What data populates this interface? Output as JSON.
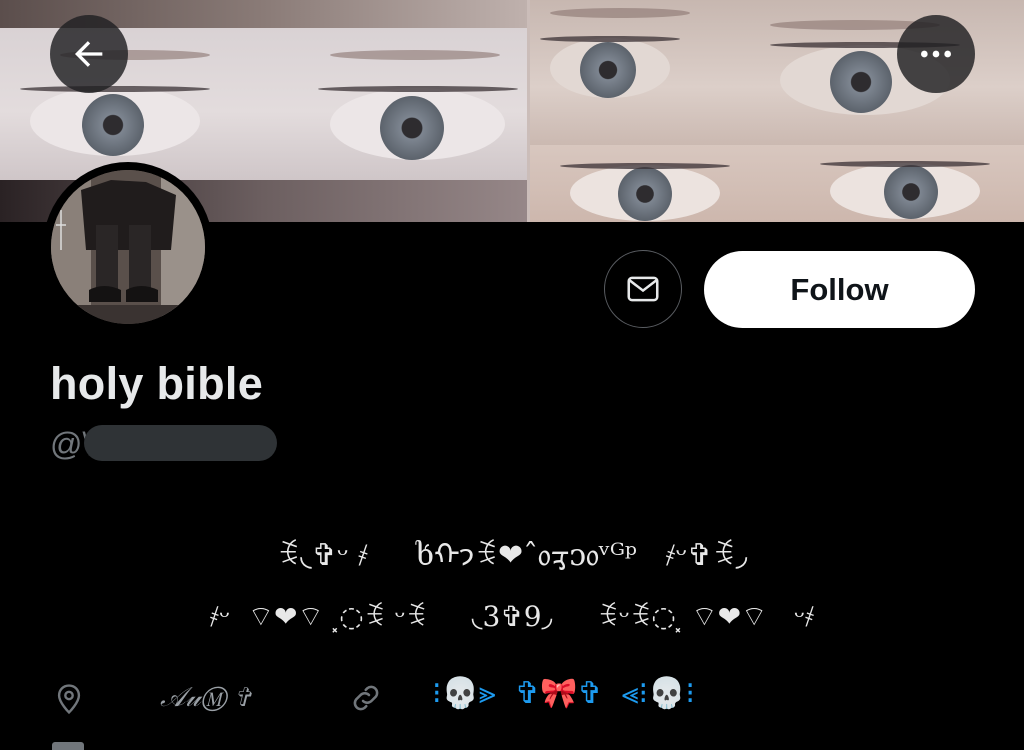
{
  "header": {
    "back_icon": "arrow-left-icon",
    "more_icon": "more-horizontal-icon"
  },
  "profile": {
    "display_name": "holy bible",
    "handle_prefix": "@\\",
    "message_icon": "envelope-icon",
    "follow_label": "Follow",
    "bio_line1": "ꉂ◟✞ᵕ ҂     ხᡣ𐭩ꉂ❤ˆ᥆ᢋᴐ᥆ᵛᴳᵖ   ҂ᵕ✞ꉂ◞",
    "bio_line2": "҂ᵕ  ⌔❤⌔ ⸼◌ꉂ ᵕꉂ     ◟3✞9◞     ꉂᵕꉂ◌⸼ ⌔❤⌔   ᵕ҂",
    "location_icon": "location-pin-icon",
    "location_text": "𝒜𝓊Ⓜ ✞",
    "link_icon": "link-icon",
    "link_text": "⁝💀⪢  ✞🎀✞  ⪡⁝💀⁝"
  },
  "colors": {
    "background": "#000000",
    "follow_bg": "#ffffff",
    "handle": "#71767b",
    "link": "#1d9bf0"
  }
}
